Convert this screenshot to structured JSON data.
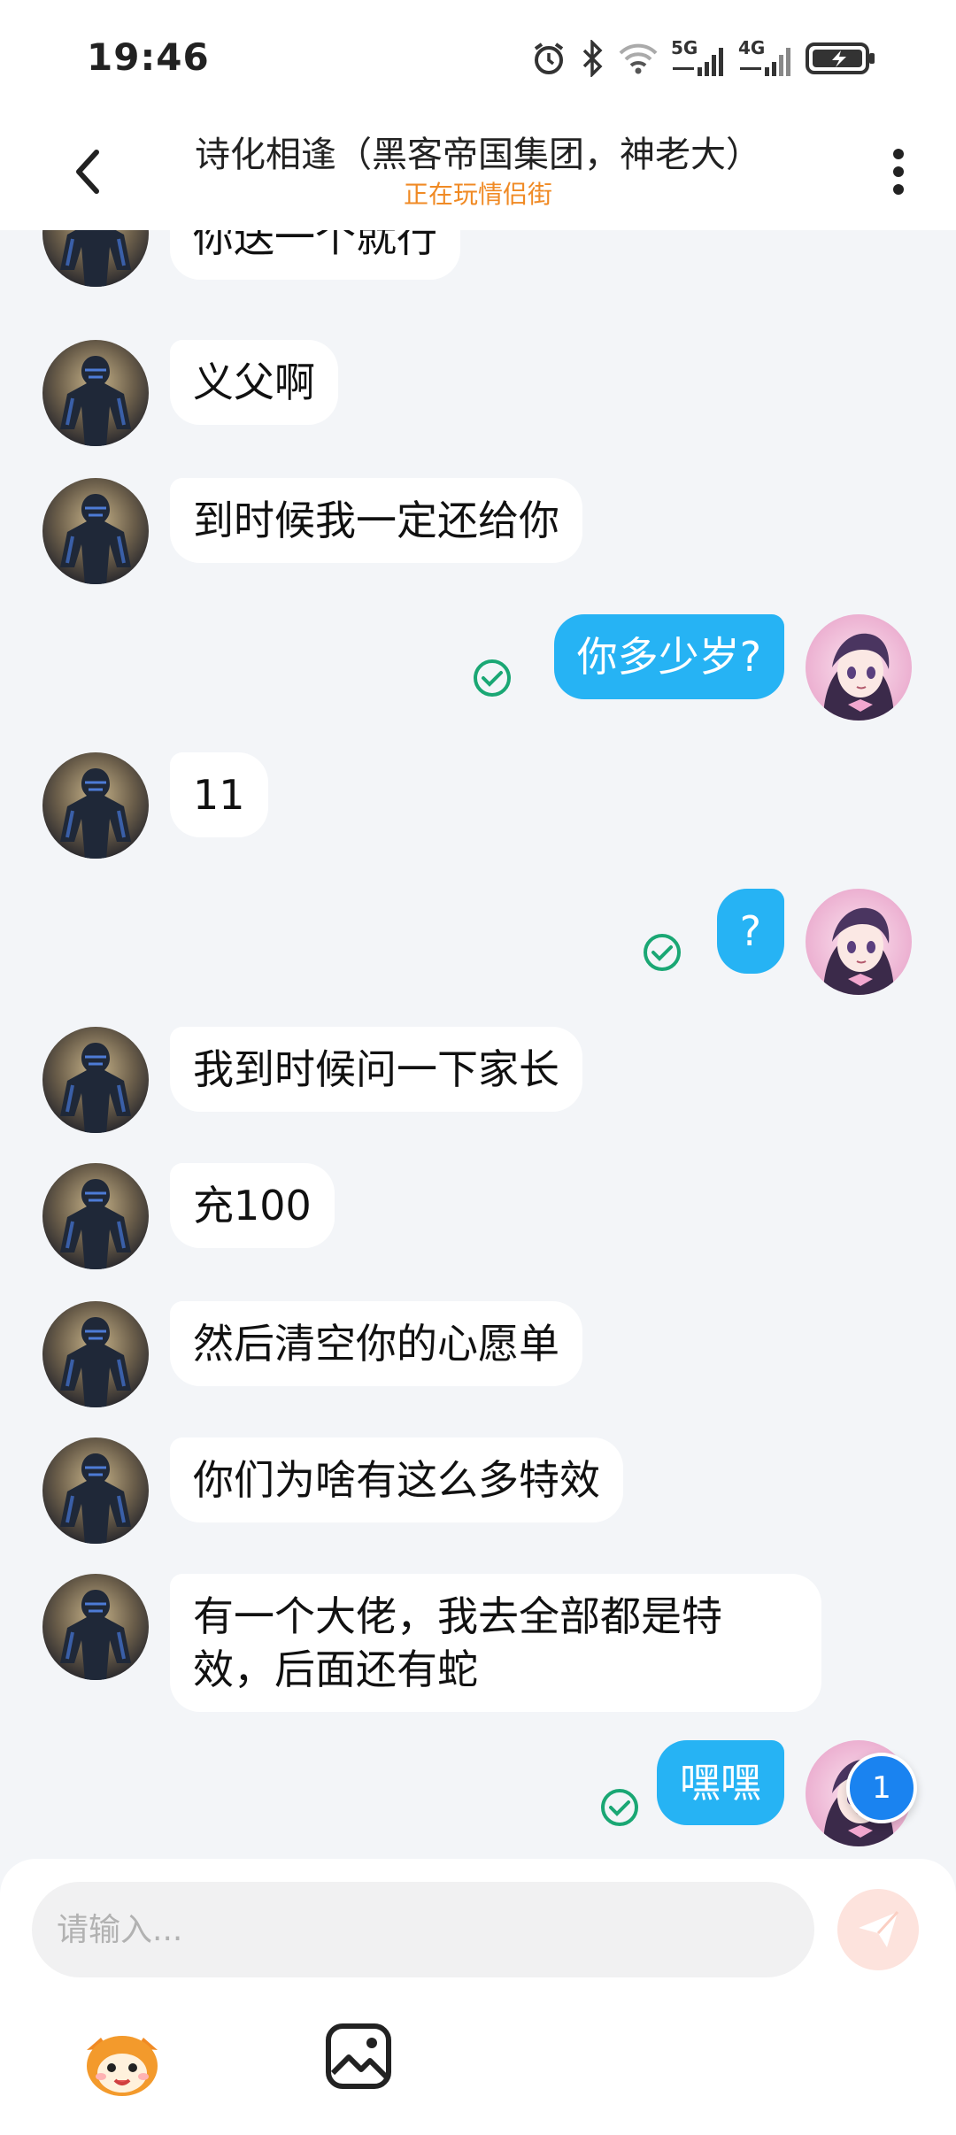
{
  "status_bar": {
    "time": "19:46",
    "icons": [
      "alarm-icon",
      "bluetooth-icon",
      "wifi-icon",
      "signal-5g-icon",
      "signal-4g-icon",
      "battery-charging-icon"
    ],
    "network_5g": "5G",
    "network_4g": "4G"
  },
  "header": {
    "title": "诗化相逢（黑客帝国集团，神老大）",
    "subtitle": "正在玩情侣街"
  },
  "messages": [
    {
      "side": "in",
      "text": "你送一个就行"
    },
    {
      "side": "in",
      "text": "义父啊"
    },
    {
      "side": "in",
      "text": "到时候我一定还给你"
    },
    {
      "side": "out",
      "text": "你多少岁?",
      "status": "read"
    },
    {
      "side": "in",
      "text": "11"
    },
    {
      "side": "out",
      "text": "?",
      "status": "read"
    },
    {
      "side": "in",
      "text": "我到时候问一下家长"
    },
    {
      "side": "in",
      "text": "充100"
    },
    {
      "side": "in",
      "text": "然后清空你的心愿单"
    },
    {
      "side": "in",
      "text": "你们为啥有这么多特效"
    },
    {
      "side": "in",
      "text": "有一个大佬，我去全部都是特效，后面还有蛇"
    },
    {
      "side": "out",
      "text": "嘿嘿",
      "status": "read"
    }
  ],
  "unread_badge": "1",
  "composer": {
    "placeholder": "请输入..."
  },
  "colors": {
    "outgoing_bubble": "#26b3f4",
    "incoming_bubble": "#ffffff",
    "subtitle": "#f08a24",
    "background": "#f3f5f8",
    "read_check": "#1aa774",
    "badge": "#1a83f0"
  }
}
